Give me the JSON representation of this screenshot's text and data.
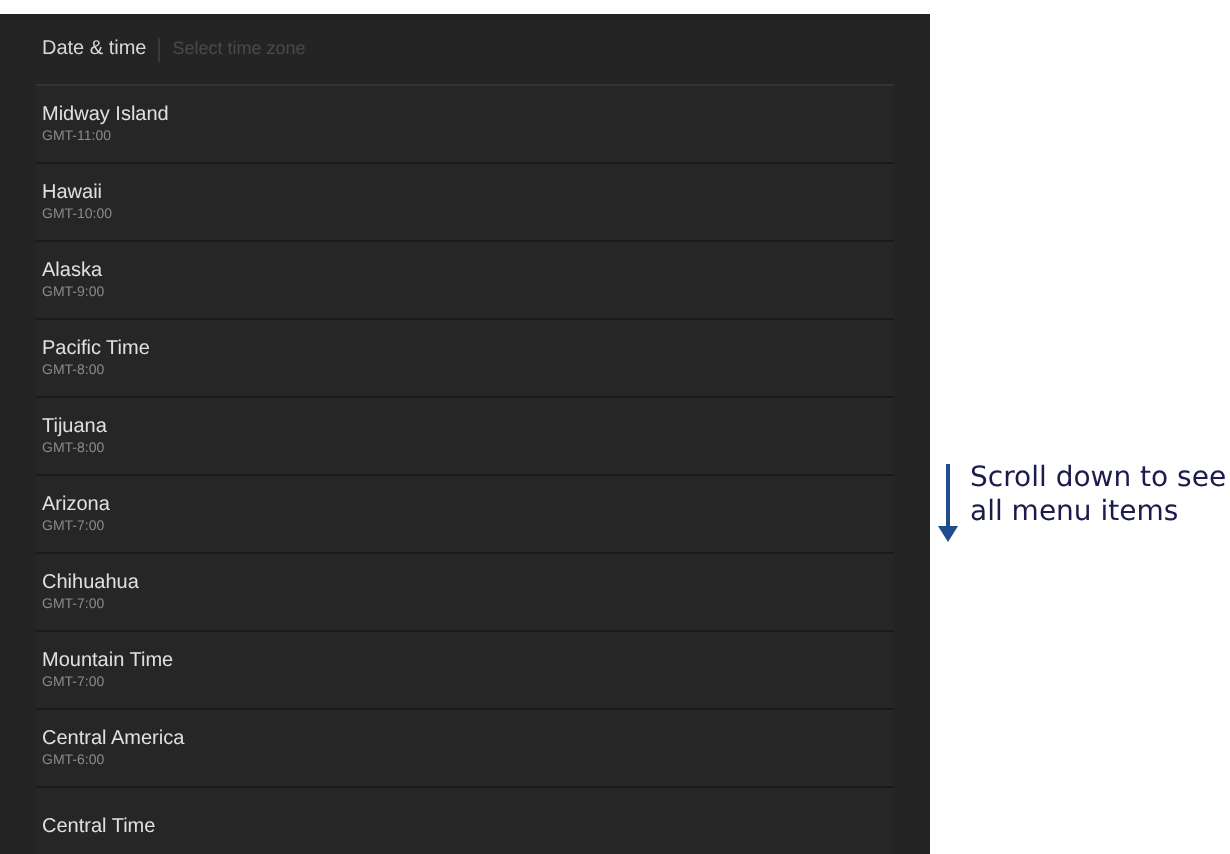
{
  "header": {
    "title": "Date & time",
    "subtitle": "Select time zone"
  },
  "zones": [
    {
      "name": "Midway Island",
      "offset": "GMT-11:00"
    },
    {
      "name": "Hawaii",
      "offset": "GMT-10:00"
    },
    {
      "name": "Alaska",
      "offset": "GMT-9:00"
    },
    {
      "name": "Pacific Time",
      "offset": "GMT-8:00"
    },
    {
      "name": "Tijuana",
      "offset": "GMT-8:00"
    },
    {
      "name": "Arizona",
      "offset": "GMT-7:00"
    },
    {
      "name": "Chihuahua",
      "offset": "GMT-7:00"
    },
    {
      "name": "Mountain Time",
      "offset": "GMT-7:00"
    },
    {
      "name": "Central America",
      "offset": "GMT-6:00"
    },
    {
      "name": "Central Time"
    }
  ],
  "callout": {
    "text": "Scroll down to see all menu items"
  }
}
